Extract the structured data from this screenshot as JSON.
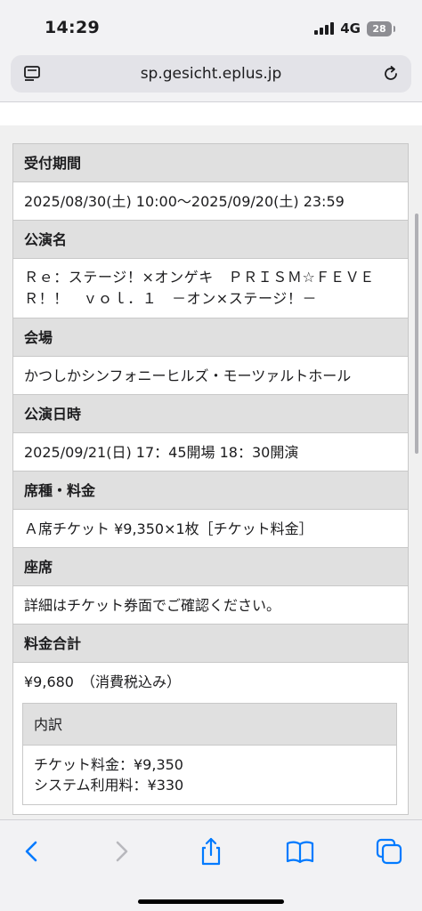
{
  "status_bar": {
    "time": "14:29",
    "network": "4G",
    "battery": "28"
  },
  "browser": {
    "url": "sp.gesicht.eplus.jp"
  },
  "details": {
    "reception_period_label": "受付期間",
    "reception_period_value": "2025/08/30(土) 10:00〜2025/09/20(土) 23:59",
    "performance_name_label": "公演名",
    "performance_name_value": "Ｒｅ：ステージ！×オンゲキ　ＰＲＩＳＭ☆ＦＥＶＥＲ！！　ｖｏｌ．１　－オン×ステージ！－",
    "venue_label": "会場",
    "venue_value": "かつしかシンフォニーヒルズ・モーツァルトホール",
    "datetime_label": "公演日時",
    "datetime_value": "2025/09/21(日) 17：45開場 18：30開演",
    "seat_type_label": "席種・料金",
    "seat_type_value": "Ａ席チケット ¥9,350×1枚［チケット料金］",
    "seat_label": "座席",
    "seat_value": "詳細はチケット券面でご確認ください。",
    "total_label": "料金合計",
    "total_value": "¥9,680　（消費税込み）",
    "breakdown_label": "内訳",
    "breakdown_ticket": "チケット料金：¥9,350",
    "breakdown_system": "システム利用料：¥330"
  },
  "toolbar": {
    "icons": [
      "chevron-left-icon",
      "chevron-right-icon",
      "share-icon",
      "bookmarks-icon",
      "tabs-icon"
    ]
  },
  "colors": {
    "accent": "#007aff",
    "header_bg": "#e0e0e0",
    "border": "#c8c8c8"
  }
}
